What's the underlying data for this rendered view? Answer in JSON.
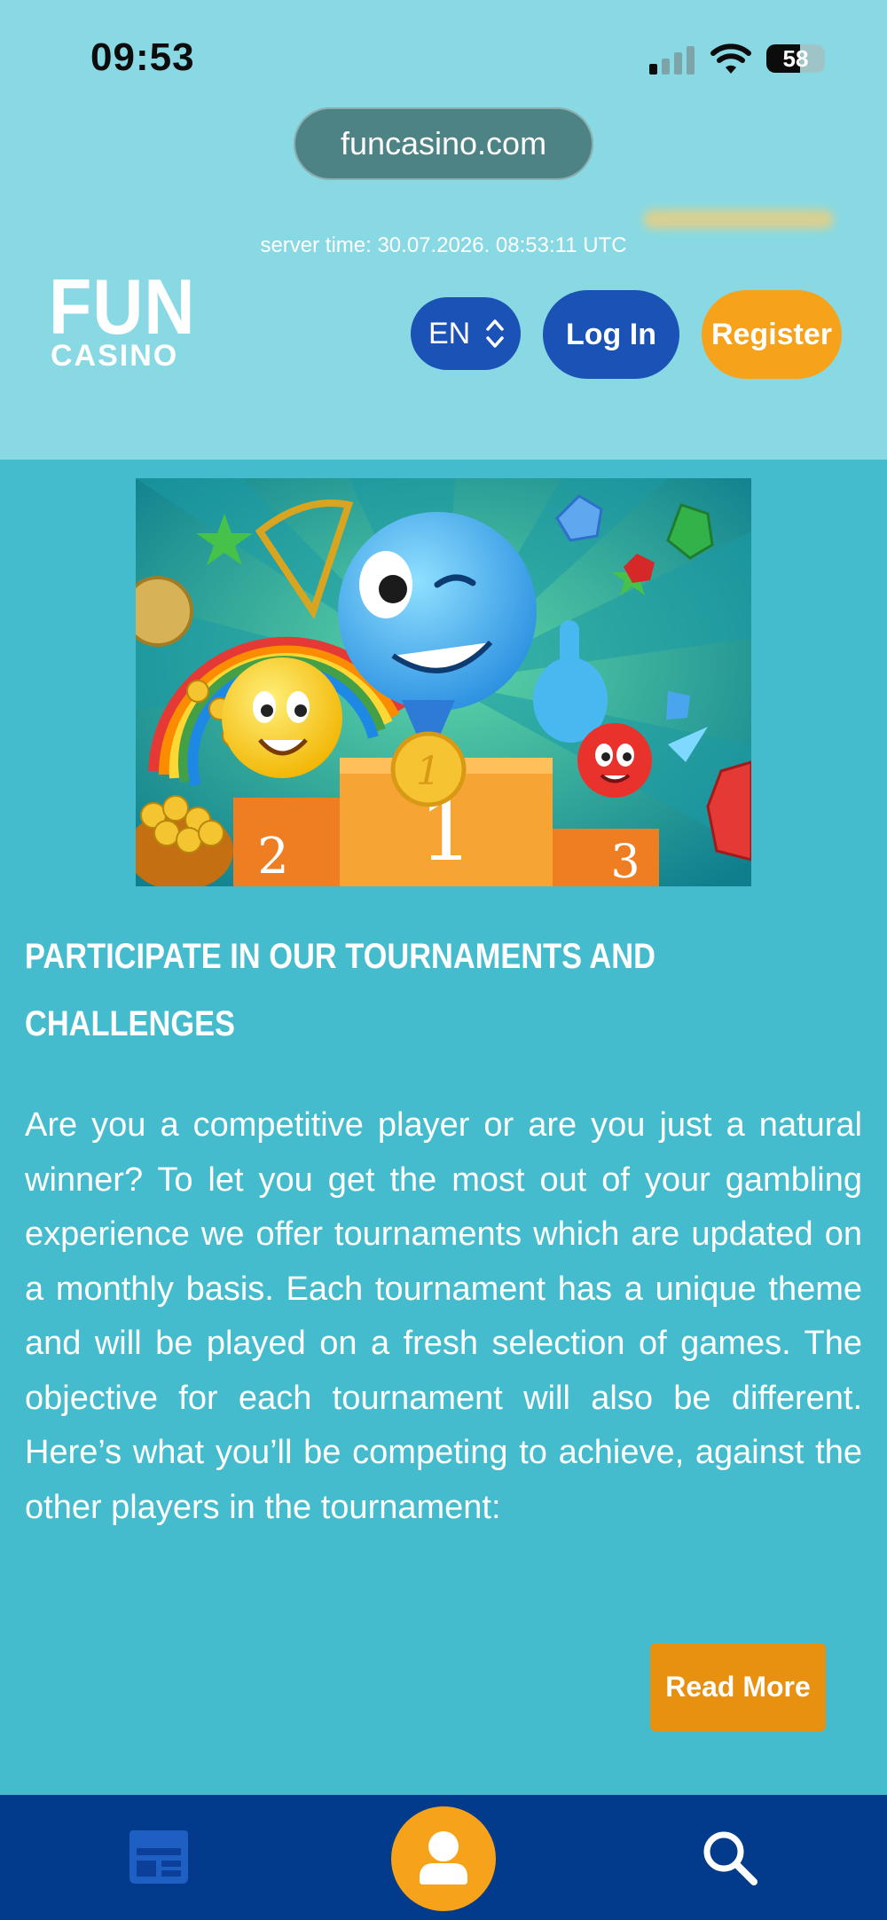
{
  "status_bar": {
    "time": "09:53",
    "battery": "58",
    "icons": [
      "signal-icon",
      "wifi-icon",
      "battery-icon"
    ]
  },
  "browser": {
    "url": "funcasino.com"
  },
  "header": {
    "server_time": "server time: 30.07.2026. 08:53:11 UTC",
    "logo_top": "FUN",
    "logo_bottom": "CASINO",
    "language": "EN",
    "login_label": "Log In",
    "register_label": "Register"
  },
  "content": {
    "hero_icon": "tournament-podium-illustration",
    "podium_labels": [
      "2",
      "1",
      "3"
    ],
    "medal_label": "1",
    "heading": "PARTICIPATE IN OUR TOURNAMENTS AND CHALLENGES",
    "body": "Are you a competitive player or are you just a natural winner? To let you get the most out of your gambling experience we offer tournaments which are updated on a monthly basis. Each tournament has a unique theme and will be played on a fresh selection of games. The objective for each tournament will also be different. Here’s what you’ll be competing to achieve, against the other players in the tournament:",
    "read_more_label": "Read More"
  },
  "bottom_nav": {
    "items": [
      "games-icon",
      "profile-icon",
      "search-icon"
    ]
  },
  "colors": {
    "header_bg": "#88d9e3",
    "page_bg": "#45bccd",
    "primary_blue": "#1a53b5",
    "accent_orange": "#f7a21b",
    "nav_bg": "#023a8c"
  }
}
